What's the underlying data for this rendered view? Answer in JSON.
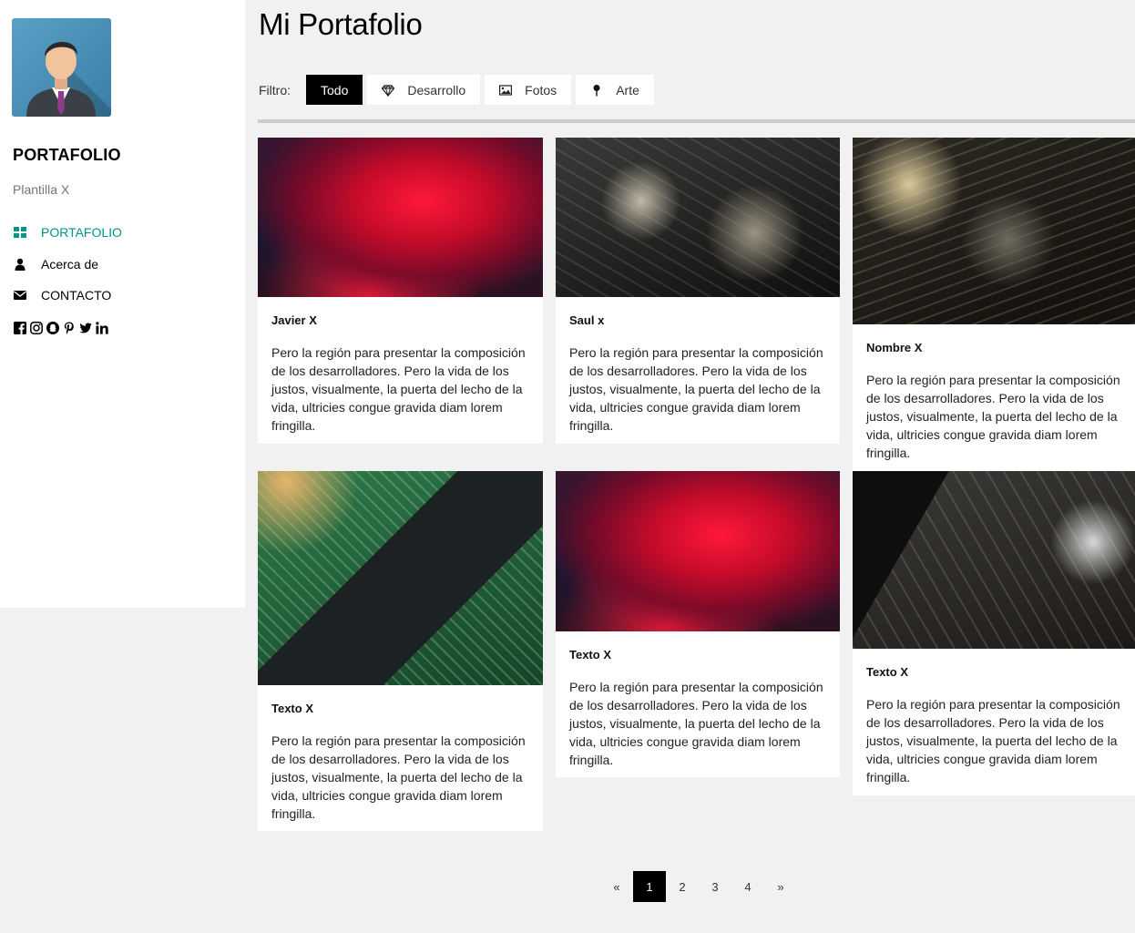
{
  "sidebar": {
    "brand": "PORTAFOLIO",
    "subtitle": "Plantilla X",
    "nav": [
      {
        "label": "PORTAFOLIO",
        "icon": "grid-icon",
        "active": true
      },
      {
        "label": "Acerca de",
        "icon": "user-icon",
        "active": false
      },
      {
        "label": "CONTACTO",
        "icon": "envelope-icon",
        "active": false
      }
    ],
    "socials": [
      "facebook-icon",
      "instagram-icon",
      "snapchat-icon",
      "pinterest-icon",
      "twitter-icon",
      "linkedin-icon"
    ]
  },
  "main": {
    "title": "Mi Portafolio",
    "filter": {
      "label": "Filtro:",
      "options": [
        {
          "label": "Todo",
          "icon": "",
          "active": true
        },
        {
          "label": "Desarrollo",
          "icon": "diamond-icon",
          "active": false
        },
        {
          "label": "Fotos",
          "icon": "photo-icon",
          "active": false
        },
        {
          "label": "Arte",
          "icon": "map-pin-icon",
          "active": false
        }
      ]
    },
    "cards": [
      {
        "title": "Javier X",
        "text": "Pero la región para presentar la composición de los desarrolladores. Pero la vida de los justos, visualmente, la puerta del lecho de la vida, ultricies congue gravida diam lorem fringilla.",
        "image": "red-forest"
      },
      {
        "title": "Saul x",
        "text": "Pero la región para presentar la composición de los desarrolladores. Pero la vida de los justos, visualmente, la puerta del lecho de la vida, ultricies congue gravida diam lorem fringilla.",
        "image": "circuit-board"
      },
      {
        "title": "Nombre X",
        "text": "Pero la región para presentar la composición de los desarrolladores. Pero la vida de los justos, visualmente, la puerta del lecho de la vida, ultricies congue gravida diam lorem fringilla.",
        "image": "circuit-board"
      },
      {
        "title": "Texto X",
        "text": "Pero la región para presentar la composición de los desarrolladores. Pero la vida de los justos, visualmente, la puerta del lecho de la vida, ultricies congue gravida diam lorem fringilla.",
        "image": "green-chip"
      },
      {
        "title": "Texto X",
        "text": "Pero la región para presentar la composición de los desarrolladores. Pero la vida de los justos, visualmente, la puerta del lecho de la vida, ultricies congue gravida diam lorem fringilla.",
        "image": "red-forest"
      },
      {
        "title": "Texto X",
        "text": "Pero la región para presentar la composición de los desarrolladores. Pero la vida de los justos, visualmente, la puerta del lecho de la vida, ultricies congue gravida diam lorem fringilla.",
        "image": "circuit-board"
      }
    ]
  },
  "pagination": {
    "prev": "«",
    "pages": [
      "1",
      "2",
      "3",
      "4"
    ],
    "current": "1",
    "next": "»"
  },
  "colors": {
    "accent": "#009688",
    "active_filter_bg": "#000000",
    "page_bg": "#f1f1f1"
  }
}
